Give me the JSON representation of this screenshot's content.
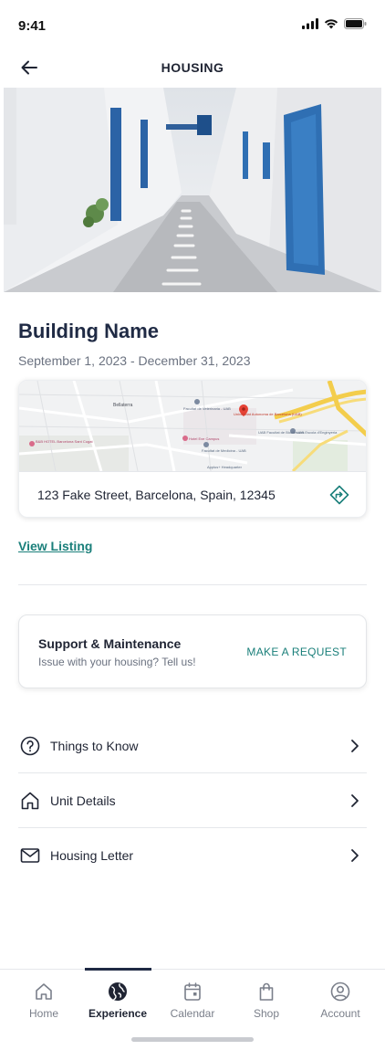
{
  "status_bar": {
    "time": "9:41"
  },
  "header": {
    "title": "HOUSING"
  },
  "building": {
    "name": "Building Name",
    "dates": "September 1, 2023 - December 31, 2023"
  },
  "map": {
    "labels": {
      "bellaterra": "Bellaterra",
      "vet": "Facultat de Veterinaria - UAB",
      "uab": "Universitat Autonoma de Barcelona (UAB)",
      "bib": "UAB Facultat de Biociencies",
      "hotel_campus": "Hotel Exe Campus",
      "medicina": "Facultat de Medicina - UAB",
      "bb_hotel": "B&B HOTEL Barcelona Sant Cugat",
      "enginyeria": "UAB Escola d'Enginyeria",
      "applus": "Applus+ Headquarter"
    },
    "address": "123 Fake Street, Barcelona, Spain, 12345"
  },
  "links": {
    "view_listing": "View Listing"
  },
  "support": {
    "title": "Support & Maintenance",
    "subtitle": "Issue with your housing? Tell us!",
    "action": "MAKE A REQUEST"
  },
  "menu": {
    "items": [
      {
        "label": "Things to Know",
        "icon": "question-circle-icon"
      },
      {
        "label": "Unit Details",
        "icon": "home-icon"
      },
      {
        "label": "Housing Letter",
        "icon": "mail-icon"
      }
    ]
  },
  "tabs": [
    {
      "label": "Home",
      "icon": "home-icon",
      "active": false
    },
    {
      "label": "Experience",
      "icon": "globe-icon",
      "active": true
    },
    {
      "label": "Calendar",
      "icon": "calendar-icon",
      "active": false
    },
    {
      "label": "Shop",
      "icon": "shopping-bag-icon",
      "active": false
    },
    {
      "label": "Account",
      "icon": "user-circle-icon",
      "active": false
    }
  ],
  "colors": {
    "accent": "#1a7f7a",
    "title": "#1f2a44",
    "muted": "#6b7280",
    "active_tab_indicator": "#1f2a44"
  }
}
